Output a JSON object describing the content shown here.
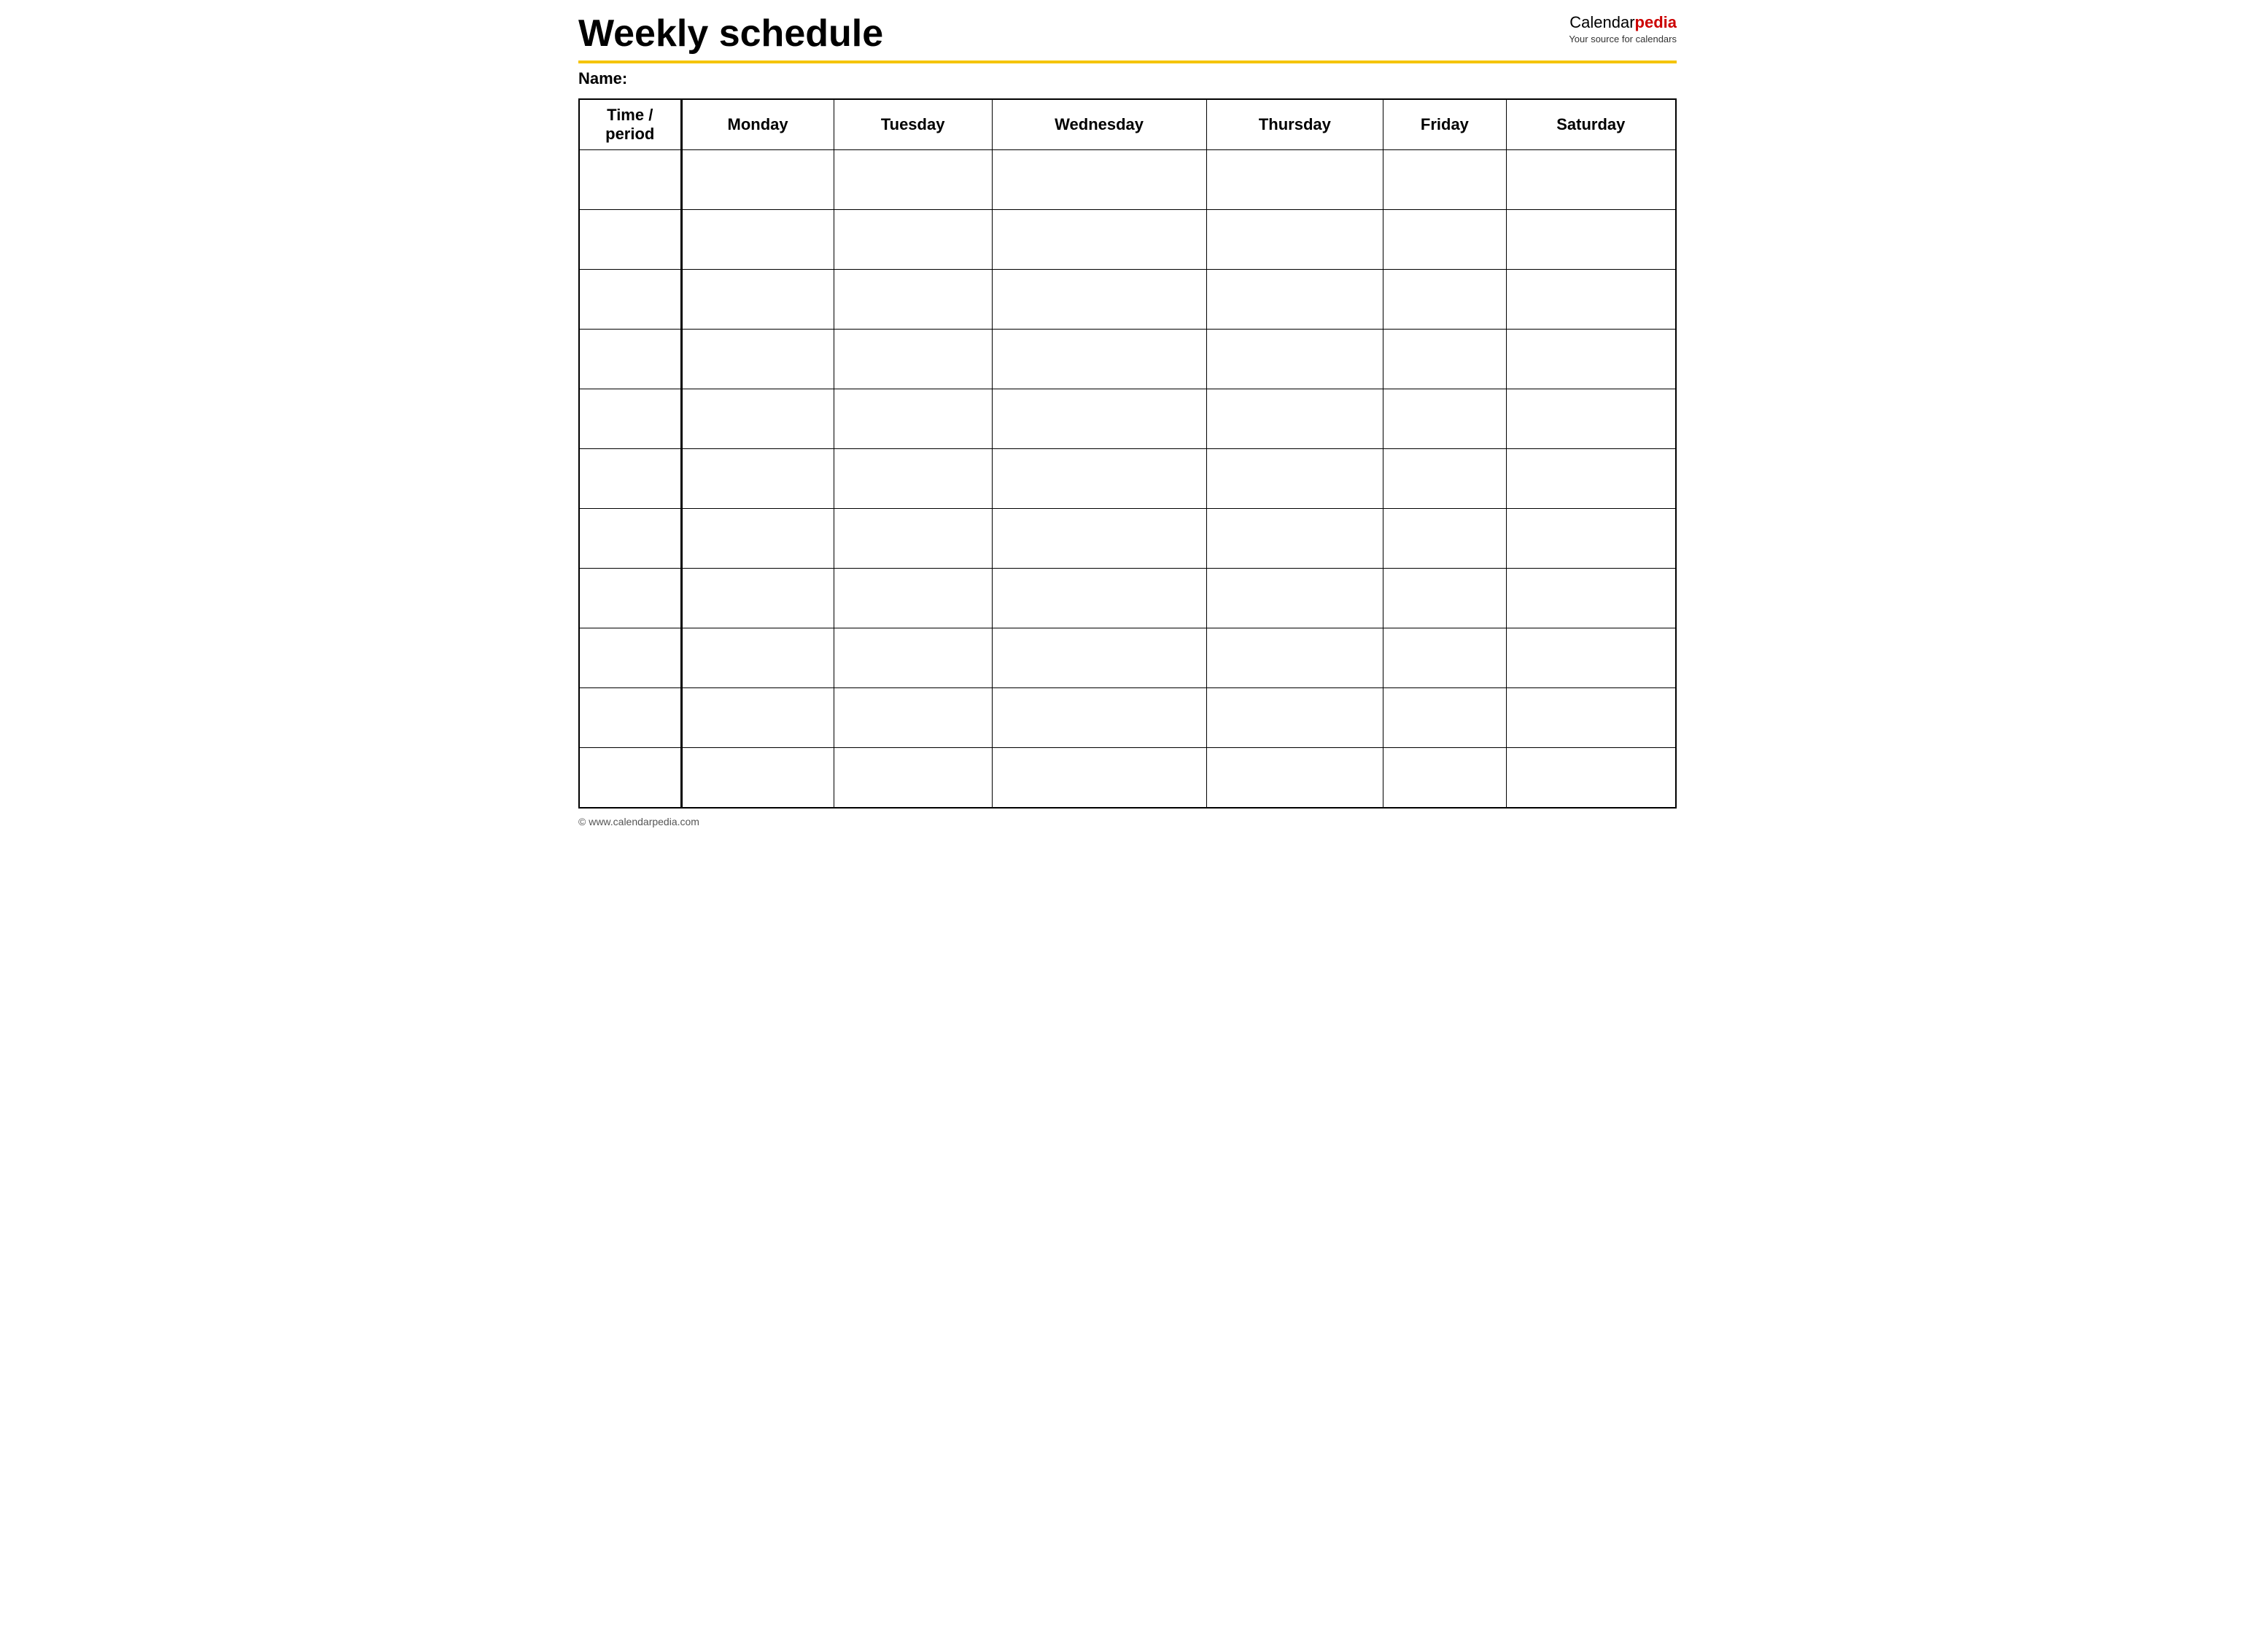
{
  "header": {
    "title": "Weekly schedule",
    "brand_calendar": "Calendar",
    "brand_pedia": "pedia",
    "brand_tagline": "Your source for calendars"
  },
  "name_label": "Name:",
  "columns": [
    "Time / period",
    "Monday",
    "Tuesday",
    "Wednesday",
    "Thursday",
    "Friday",
    "Saturday"
  ],
  "num_rows": 11,
  "footer": {
    "url": "© www.calendarpedia.com"
  }
}
